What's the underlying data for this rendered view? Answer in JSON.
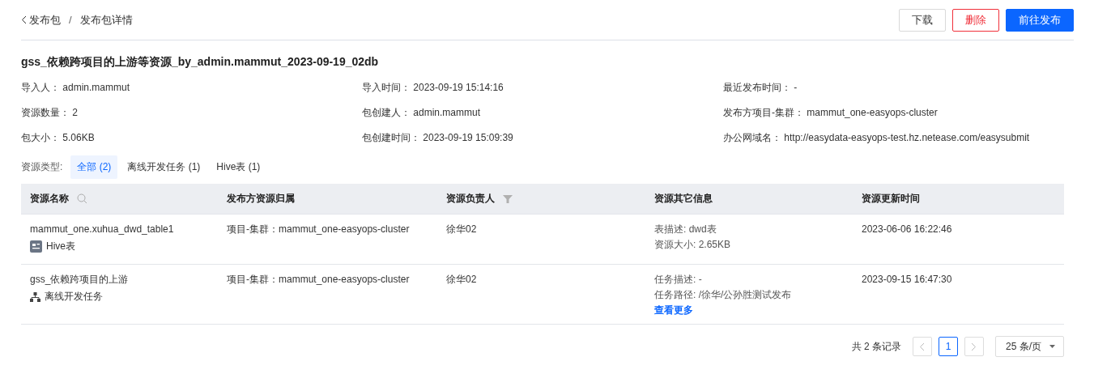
{
  "breadcrumb": {
    "back": "发布包",
    "separator": "/",
    "current": "发布包详情"
  },
  "actions": [
    {
      "kind": "default",
      "label": "下载"
    },
    {
      "kind": "danger",
      "label": "删除"
    },
    {
      "kind": "primary",
      "label": "前往发布"
    }
  ],
  "title": "gss_依赖跨项目的上游等资源_by_admin.mammut_2023-09-19_02db",
  "info": [
    {
      "label": "导入人：",
      "value": "admin.mammut"
    },
    {
      "label": "导入时间：",
      "value": "2023-09-19 15:14:16"
    },
    {
      "label": "最近发布时间：",
      "value": "-"
    },
    {
      "label": "资源数量：",
      "value": "2"
    },
    {
      "label": "包创建人：",
      "value": "admin.mammut"
    },
    {
      "label": "发布方项目-集群：",
      "value": "mammut_one-easyops-cluster"
    },
    {
      "label": "包大小：",
      "value": "5.06KB"
    },
    {
      "label": "包创建时间：",
      "value": "2023-09-19 15:09:39"
    },
    {
      "label": "办公网域名：",
      "value": "http://easydata-easyops-test.hz.netease.com/easysubmit"
    }
  ],
  "type_filter": {
    "label": "资源类型:",
    "options": [
      {
        "label": "全部 (2)",
        "selected": true
      },
      {
        "label": "离线开发任务 (1)",
        "selected": false
      },
      {
        "label": "Hive表 (1)",
        "selected": false
      }
    ]
  },
  "table": {
    "columns": [
      {
        "label": "资源名称"
      },
      {
        "label": "发布方资源归属"
      },
      {
        "label": "资源负责人"
      },
      {
        "label": "资源其它信息"
      },
      {
        "label": "资源更新时间"
      }
    ],
    "rows": [
      {
        "name": "mammut_one.xuhua_dwd_table1",
        "type": {
          "kind": "hive",
          "label": "Hive表"
        },
        "owner_project": "项目-集群：mammut_one-easyops-cluster",
        "owner": "徐华02",
        "info": [
          "表描述: dwd表",
          "资源大小: 2.65KB"
        ],
        "updated": "2023-06-06 16:22:46"
      },
      {
        "name": "gss_依赖跨项目的上游",
        "type": {
          "kind": "task",
          "label": "离线开发任务"
        },
        "owner_project": "项目-集群：mammut_one-easyops-cluster",
        "owner": "徐华02",
        "info": [
          "任务描述: -",
          "任务路径: /徐华/公孙胜测试发布"
        ],
        "more_link": "查看更多",
        "updated": "2023-09-15 16:47:30"
      }
    ]
  },
  "pagination": {
    "total": "共 2 条记录",
    "pages": [
      {
        "label": "1",
        "selected": true
      }
    ],
    "prev_disabled": true,
    "next_disabled": true,
    "page_size": "25 条/页"
  }
}
